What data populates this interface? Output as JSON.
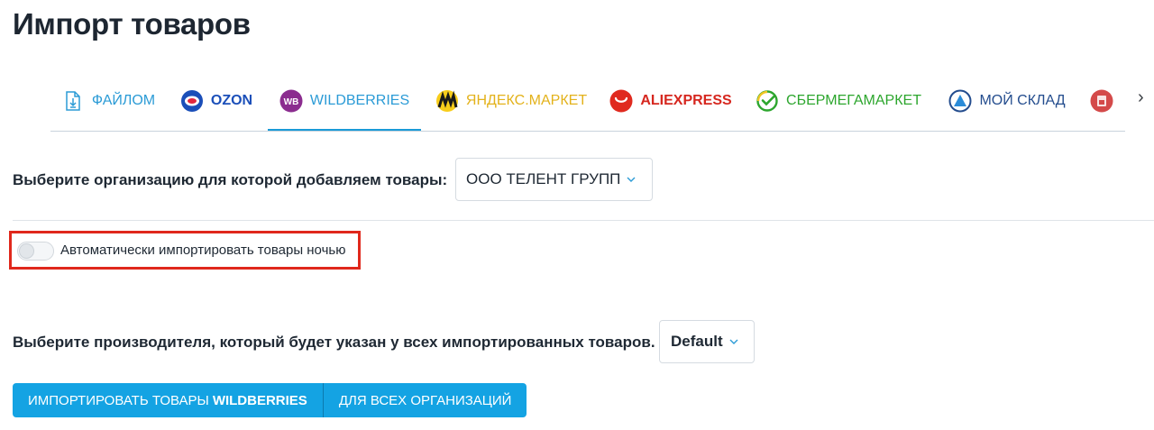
{
  "page": {
    "title": "Импорт товаров"
  },
  "tabs": [
    {
      "label": "ФАЙЛОМ",
      "icon": "file-download-icon",
      "color": "#2b9bd6"
    },
    {
      "label": "OZON",
      "icon": "ozon-logo-icon",
      "color": "#1b4fb9"
    },
    {
      "label": "WILDBERRIES",
      "icon": "wildberries-logo-icon",
      "color": "#2b9bd6",
      "active": true
    },
    {
      "label": "ЯНДЕКС.МАРКЕТ",
      "icon": "yandex-market-logo-icon",
      "color": "#e3b21b"
    },
    {
      "label": "ALIEXPRESS",
      "icon": "aliexpress-logo-icon",
      "color": "#d6271f"
    },
    {
      "label": "СБЕРМЕГАМАРКЕТ",
      "icon": "sbermegamarket-logo-icon",
      "color": "#2da62e"
    },
    {
      "label": "МОЙ СКЛАД",
      "icon": "moysklad-logo-icon",
      "color": "#244d8e"
    },
    {
      "label": "",
      "icon": "store-logo-icon",
      "color": "#d44a4a"
    }
  ],
  "tabs_next": {
    "label": "›",
    "icon": "chevron-right-icon"
  },
  "organization": {
    "label": "Выберите организацию для которой добавляем товары:",
    "value": "ООО ТЕЛЕНТ ГРУПП"
  },
  "auto_import": {
    "label": "Автоматически импортировать товары ночью",
    "enabled": false
  },
  "manufacturer": {
    "label": "Выберите производителя, который будет указан у всех импортированных товаров.",
    "value": "Default"
  },
  "actions": {
    "import_prefix": "ИМПОРТИРОВАТЬ ТОВАРЫ",
    "import_marketplace": "WILDBERRIES",
    "all_orgs": "ДЛЯ ВСЕХ ОРГАНИЗАЦИЙ"
  },
  "colors": {
    "accent": "#14a3e3",
    "highlight": "#e0281c"
  }
}
